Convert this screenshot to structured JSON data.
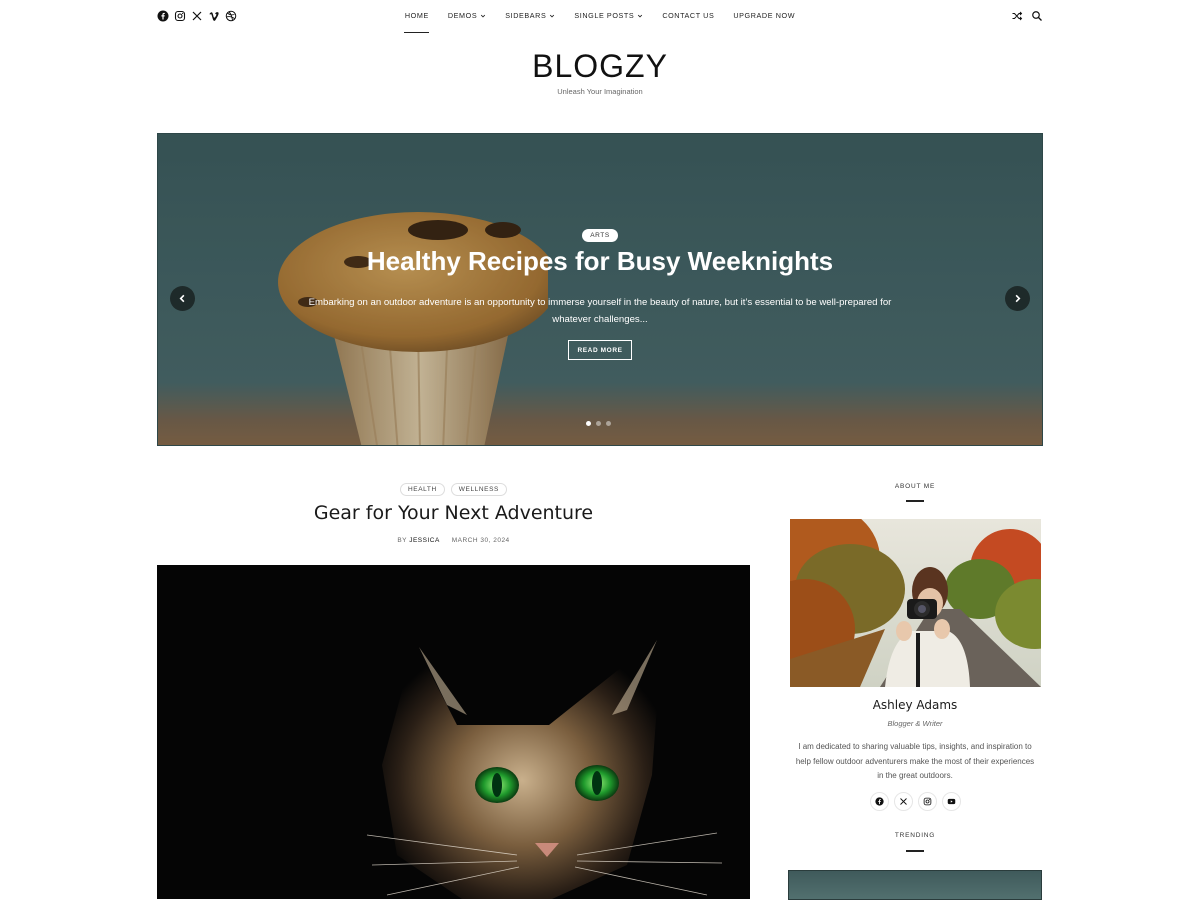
{
  "header": {
    "social_icons": [
      "facebook-icon",
      "instagram-icon",
      "x-icon",
      "vimeo-icon",
      "dribbble-icon"
    ],
    "nav": [
      {
        "label": "Home",
        "active": true,
        "dropdown": false
      },
      {
        "label": "Demos",
        "active": false,
        "dropdown": true
      },
      {
        "label": "Sidebars",
        "active": false,
        "dropdown": true
      },
      {
        "label": "Single Posts",
        "active": false,
        "dropdown": true
      },
      {
        "label": "Contact Us",
        "active": false,
        "dropdown": false
      },
      {
        "label": "Upgrade Now",
        "active": false,
        "dropdown": false
      }
    ],
    "right_icons": [
      "shuffle-icon",
      "search-icon"
    ]
  },
  "site": {
    "logo": "BLOGZY",
    "tagline": "Unleash Your Imagination"
  },
  "hero": {
    "category": "ARTS",
    "title": "Healthy Recipes for Busy Weeknights",
    "excerpt": "Embarking on an outdoor adventure is an opportunity to immerse yourself in the beauty of nature, but it’s essential to be well-prepared for whatever challenges...",
    "button": "READ MORE",
    "slide_count": 3,
    "active_slide": 1
  },
  "post": {
    "categories": [
      "HEALTH",
      "WELLNESS"
    ],
    "title": "Gear for Your Next Adventure",
    "by": "BY",
    "author": "JESSICA",
    "date": "MARCH 30, 2024"
  },
  "sidebar": {
    "about_title": "ABOUT ME",
    "name": "Ashley Adams",
    "role": "Blogger & Writer",
    "bio": "I am dedicated to sharing valuable tips, insights, and inspiration to help fellow outdoor adventurers make the most of their experiences in the great outdoors.",
    "social_icons": [
      "facebook-icon",
      "x-icon",
      "instagram-icon",
      "youtube-icon"
    ],
    "trending_title": "TRENDING"
  },
  "colors": {
    "text": "#1a1a1a",
    "hero_bg": "#46676a",
    "arrow_bg": "#1e2a2a"
  }
}
